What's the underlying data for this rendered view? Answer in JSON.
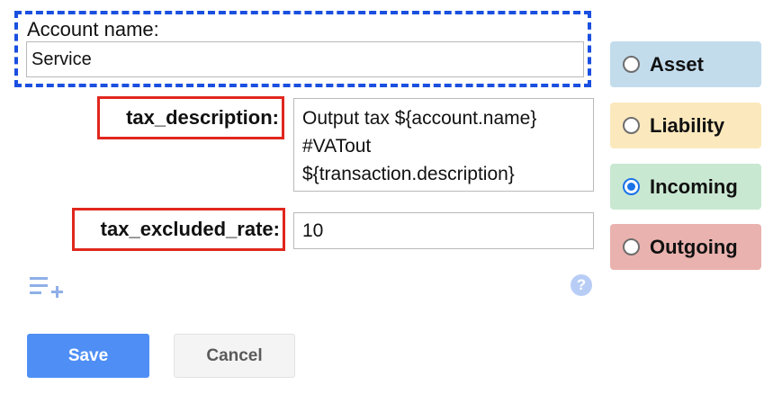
{
  "account": {
    "label": "Account name:",
    "value": "Service"
  },
  "properties": [
    {
      "key": "tax_description:",
      "value_lines": [
        "Output tax ${account.name}",
        "#VATout",
        "${transaction.description}"
      ]
    },
    {
      "key": "tax_excluded_rate:",
      "value_lines": [
        "10"
      ]
    }
  ],
  "account_types": {
    "selected": "Incoming",
    "options": [
      {
        "label": "Asset",
        "color": "#c2dcec"
      },
      {
        "label": "Liability",
        "color": "#fbe9bd"
      },
      {
        "label": "Incoming",
        "color": "#c9e8d1"
      },
      {
        "label": "Outgoing",
        "color": "#eab2ae"
      }
    ]
  },
  "icons": {
    "add_property": "playlist-add-icon",
    "help": "help-icon",
    "help_glyph": "?"
  },
  "buttons": {
    "save": "Save",
    "cancel": "Cancel"
  },
  "colors": {
    "focus_outline": "#1a4fe0",
    "highlight": "#e0271e",
    "save": "#4f8ff5",
    "radio_selected": "#1a73e8"
  }
}
